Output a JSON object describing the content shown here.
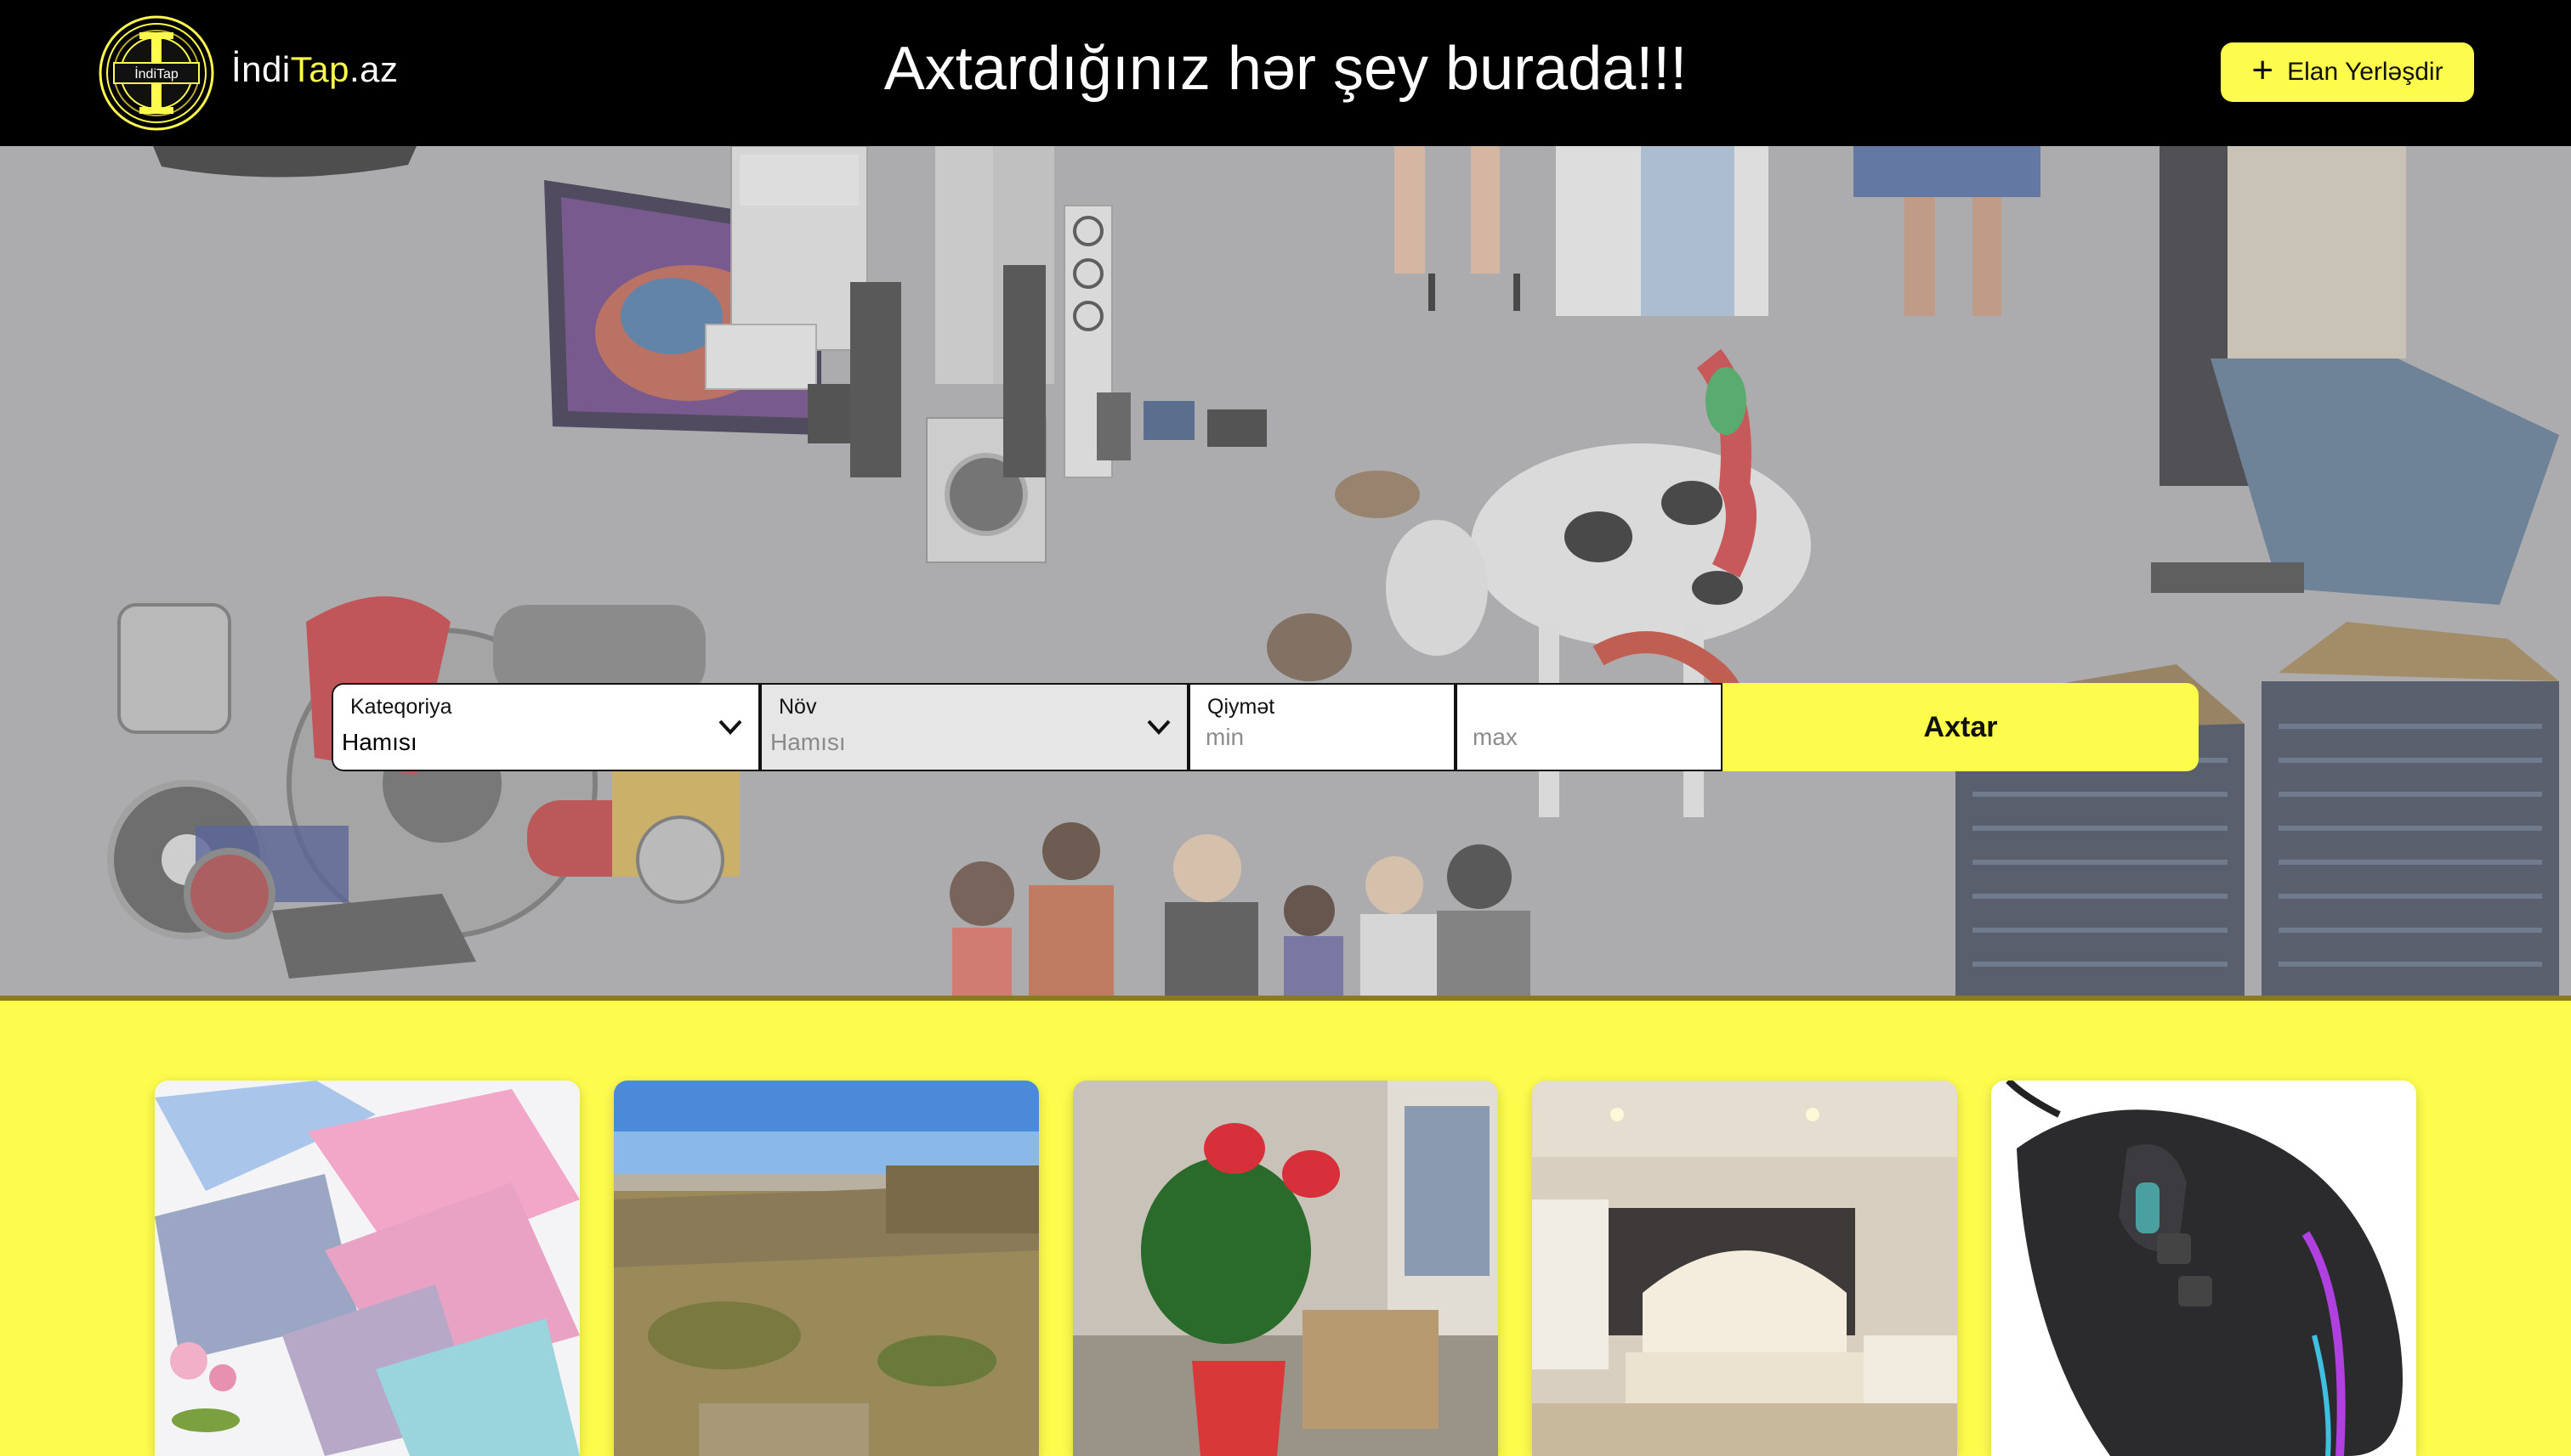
{
  "header": {
    "logo_badge": "İndiTap",
    "brand_prefix": "İndi",
    "brand_accent": "Tap",
    "brand_suffix": ".az",
    "headline": "Axtardığınız hər şey burada!!!",
    "post_button_label": "Elan Yerləşdir",
    "post_button_icon": "plus-icon"
  },
  "search": {
    "category": {
      "label": "Kateqoriya",
      "value": "Hamısı"
    },
    "type": {
      "label": "Növ",
      "value": "Hamısı"
    },
    "price": {
      "label": "Qiymət",
      "min_placeholder": "min",
      "max_placeholder": "max"
    },
    "submit_label": "Axtar"
  },
  "listings": [
    {
      "image": "fabric-rolls-photo"
    },
    {
      "image": "empty-land-plot-photo"
    },
    {
      "image": "potted-anthurium-photo"
    },
    {
      "image": "bedroom-furniture-photo"
    },
    {
      "image": "gaming-mouse-photo"
    }
  ],
  "colors": {
    "accent_yellow": "#fdfc4d",
    "header_bg": "#000000",
    "hero_overlay": "#a9a9ab"
  }
}
